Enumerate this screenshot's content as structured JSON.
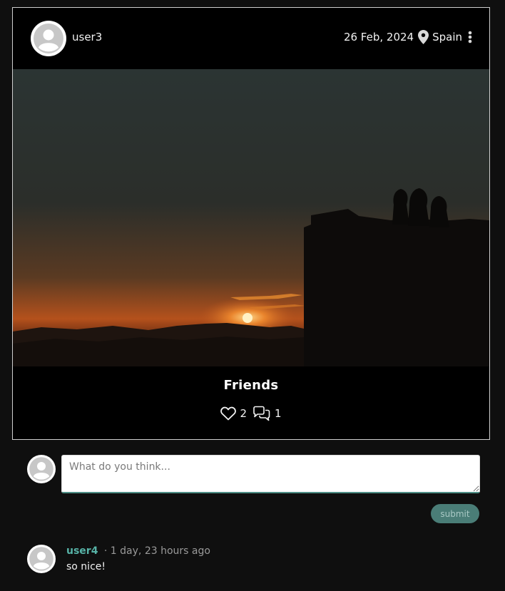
{
  "post": {
    "author": "user3",
    "date": "26 Feb, 2024",
    "location": "Spain",
    "title": "Friends",
    "likes_count": "2",
    "comments_count": "1",
    "image_alt": "Sunset silhouette of friends on a castle wall"
  },
  "comment_form": {
    "placeholder": "What do you think...",
    "submit_label": "submit"
  },
  "comments": [
    {
      "author": "user4",
      "time": "· 1 day, 23 hours ago",
      "text": "so nice!"
    }
  ],
  "colors": {
    "accent": "#57b3a7",
    "submit_bg": "#4a7d77",
    "page_bg": "#0f0f0f",
    "card_bg": "#000000"
  },
  "icons": {
    "location": "map-pin-icon",
    "menu": "vertical-dots-icon",
    "like": "heart-icon",
    "comments": "chat-bubbles-icon",
    "avatar": "default-user-avatar-icon"
  }
}
